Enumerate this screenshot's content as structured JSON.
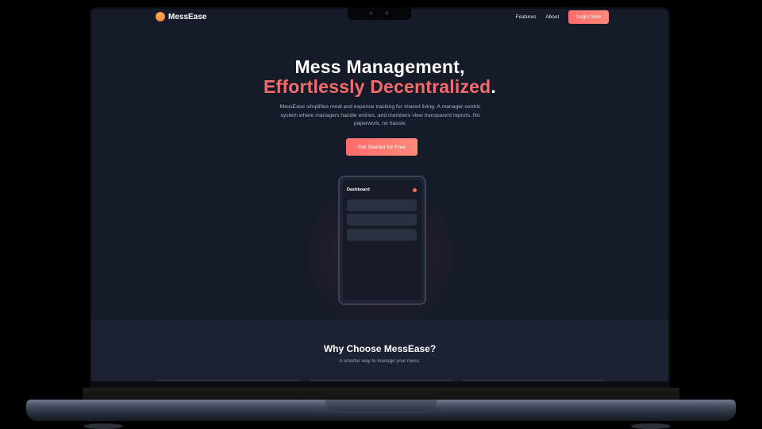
{
  "brand": {
    "name": "MessEase"
  },
  "nav": {
    "features": "Features",
    "about": "About",
    "login": "Login Now"
  },
  "hero": {
    "title_line1": "Mess Management,",
    "title_line2": "Effortlessly Decentralized",
    "title_punct": ".",
    "description": "MessEase simplifies meal and expense tracking for shared living. A manager-centric system where managers handle entries, and members view transparent reports. No paperwork, no hassle.",
    "cta": "Get Started for Free"
  },
  "mockup": {
    "title": "Dashboard"
  },
  "features": {
    "title": "Why Choose MessEase?",
    "subtitle": "A smarter way to manage your mess."
  },
  "colors": {
    "accent": "#f86b6b",
    "background": "#161b29",
    "section": "#1c2232"
  }
}
